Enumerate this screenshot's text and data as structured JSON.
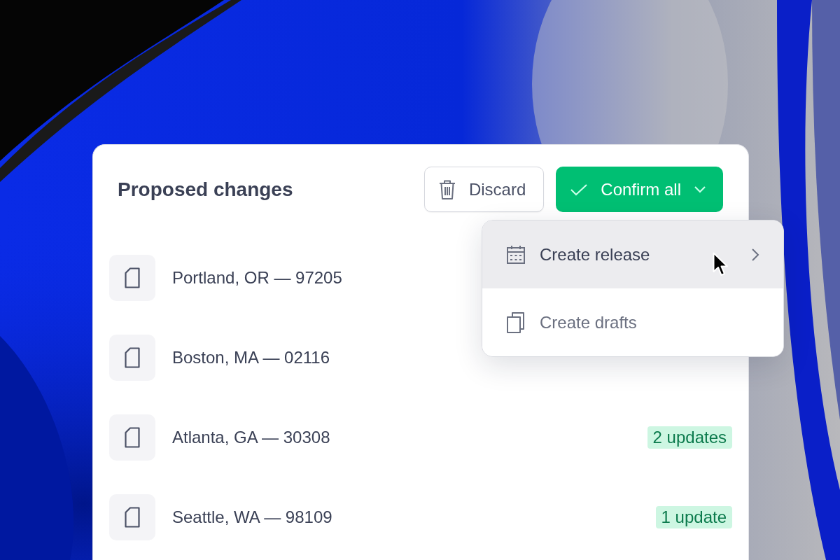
{
  "title": "Proposed changes",
  "actions": [
    {
      "kind": "secondary",
      "label": "Discard"
    },
    {
      "kind": "primary",
      "label": "Confirm all"
    }
  ],
  "menu": {
    "open": true,
    "items": [
      {
        "label": "Create release",
        "selected": true,
        "submenu": true
      },
      {
        "label": "Create drafts",
        "selected": false,
        "submenu": false
      }
    ]
  },
  "rows": [
    {
      "name": "Portland, OR — 97205"
    },
    {
      "name": "Boston, MA — 02116"
    },
    {
      "name": "Atlanta, GA — 30308",
      "badge": "2 updates"
    },
    {
      "name": "Seattle, WA — 98109",
      "badge": "1 update"
    }
  ]
}
